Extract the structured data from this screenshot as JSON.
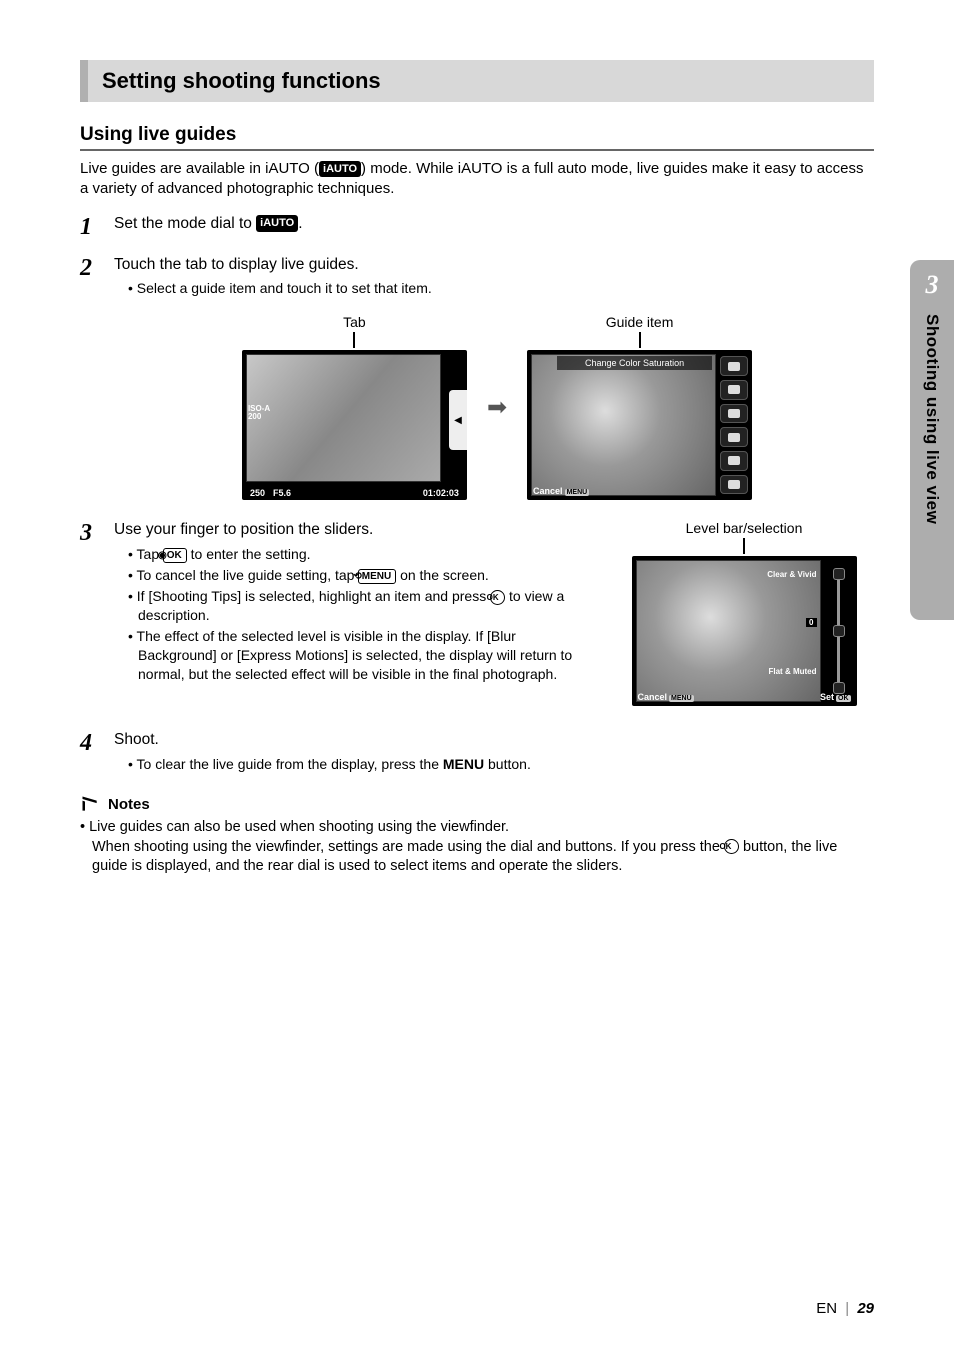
{
  "section_title": "Setting shooting functions",
  "subheading": "Using live guides",
  "intro_a": "Live guides are available in iAUTO (",
  "intro_b": ") mode. While iAUTO is a full auto mode, live guides make it easy to access a variety of advanced photographic techniques.",
  "iauto_chip": "iAUTO",
  "steps": {
    "s1": {
      "num": "1",
      "text_a": "Set the mode dial to ",
      "text_b": "."
    },
    "s2": {
      "num": "2",
      "text": "Touch the tab to display live guides.",
      "bullet": "Select a guide item and touch it to set that item."
    },
    "s3": {
      "num": "3",
      "text": "Use your finger to position the sliders.",
      "b1_a": "Tap ",
      "b1_btn": "◉OK",
      "b1_b": " to enter the setting.",
      "b2_a": "To cancel the live guide setting, tap ",
      "b2_btn": "⟲MENU",
      "b2_b": " on the screen.",
      "b3_a": "If [Shooting Tips] is selected, highlight an item and press ",
      "b3_b": " to view a description.",
      "b4": "The effect of the selected level is visible in the display. If [Blur Background] or [Express Motions] is selected, the display will return to normal, but the selected effect will be visible in the final photograph."
    },
    "s4": {
      "num": "4",
      "text": "Shoot.",
      "b1_a": "To clear the live guide from the display, press the ",
      "b1_menu": "MENU",
      "b1_b": " button."
    }
  },
  "fig": {
    "tab_label": "Tab",
    "guide_label": "Guide item",
    "level_label": "Level bar/selection",
    "lcd1": {
      "iso_top": "ISO-A",
      "iso_bot": "200",
      "shutter": "250",
      "ap": "F5.6",
      "time": "01:02:03"
    },
    "lcd2": {
      "title": "Change Color Saturation",
      "cancel": "Cancel",
      "menu": "MENU"
    },
    "lcd3": {
      "top": "Clear & Vivid",
      "mid": "0",
      "bot": "Flat & Muted",
      "cancel": "Cancel",
      "menu": "MENU",
      "set": "Set",
      "ok": "OK"
    }
  },
  "ok_label": "OK",
  "notes": {
    "head": "Notes",
    "line1": "Live guides can also be used when shooting using the viewfinder.",
    "line2_a": "When shooting using the viewfinder, settings are made using the dial and buttons. If you press the ",
    "line2_b": " button, the live guide is displayed, and the rear dial is used to select items and operate the sliders."
  },
  "side": {
    "chapter": "3",
    "title": "Shooting using live view"
  },
  "footer": {
    "lang": "EN",
    "page": "29"
  }
}
